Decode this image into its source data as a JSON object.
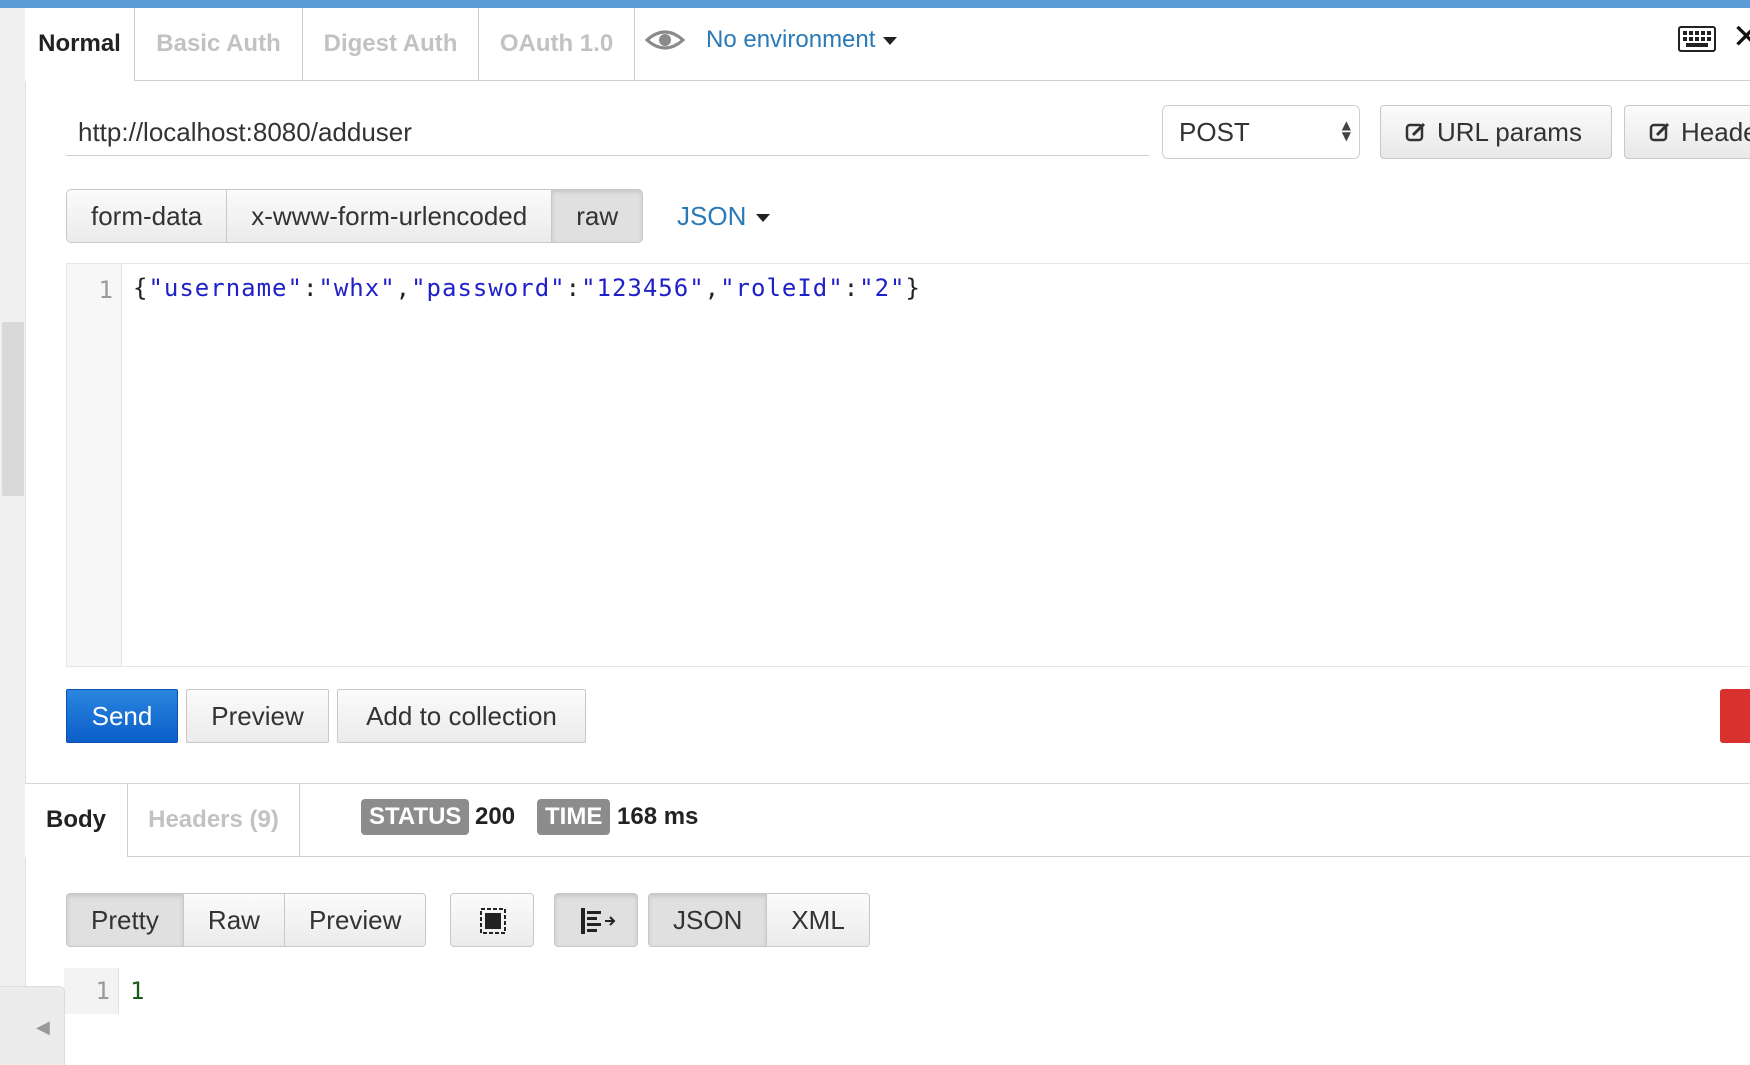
{
  "request_tabs": [
    "Normal",
    "Basic Auth",
    "Digest Auth",
    "OAuth 1.0"
  ],
  "environment": {
    "label": "No environment"
  },
  "url": {
    "value": "http://localhost:8080/adduser"
  },
  "method": {
    "selected": "POST"
  },
  "header_buttons": {
    "url_params": "URL params",
    "headers": "Headers"
  },
  "body_types": [
    "form-data",
    "x-www-form-urlencoded",
    "raw"
  ],
  "body_type_active": "raw",
  "raw_format": "JSON",
  "editor": {
    "line_number": "1",
    "tokens": [
      {
        "t": "{",
        "k": "punc"
      },
      {
        "t": "\"username\"",
        "k": "str"
      },
      {
        "t": ":",
        "k": "punc"
      },
      {
        "t": "\"whx\"",
        "k": "str"
      },
      {
        "t": ",",
        "k": "punc"
      },
      {
        "t": "\"password\"",
        "k": "str"
      },
      {
        "t": ":",
        "k": "punc"
      },
      {
        "t": "\"123456\"",
        "k": "str"
      },
      {
        "t": ",",
        "k": "punc"
      },
      {
        "t": "\"roleId\"",
        "k": "str"
      },
      {
        "t": ":",
        "k": "punc"
      },
      {
        "t": "\"2\"",
        "k": "str"
      },
      {
        "t": "}",
        "k": "punc"
      }
    ]
  },
  "actions": {
    "send": "Send",
    "preview": "Preview",
    "add_to_collection": "Add to collection"
  },
  "response_tabs": [
    "Body",
    "Headers (9)"
  ],
  "status": {
    "label": "STATUS",
    "value": "200"
  },
  "time": {
    "label": "TIME",
    "value": "168 ms"
  },
  "view_modes": [
    "Pretty",
    "Raw",
    "Preview"
  ],
  "view_mode_active": "Pretty",
  "formats": [
    "JSON",
    "XML"
  ],
  "format_active": "JSON",
  "response_body": {
    "line_number": "1",
    "content": "1"
  },
  "icons": {
    "environment": "eye-icon",
    "keyboard": "keyboard-icon",
    "close": "close-icon",
    "edit": "edit-icon",
    "fullscreen": "fullscreen-icon",
    "wrap": "wrap-icon",
    "collapse": "collapse-arrow-icon"
  },
  "colors": {
    "accent_blue": "#2a7ab8",
    "send_button": "#1a6fd6",
    "top_bar": "#5b9bd8",
    "danger": "#d9322e"
  }
}
